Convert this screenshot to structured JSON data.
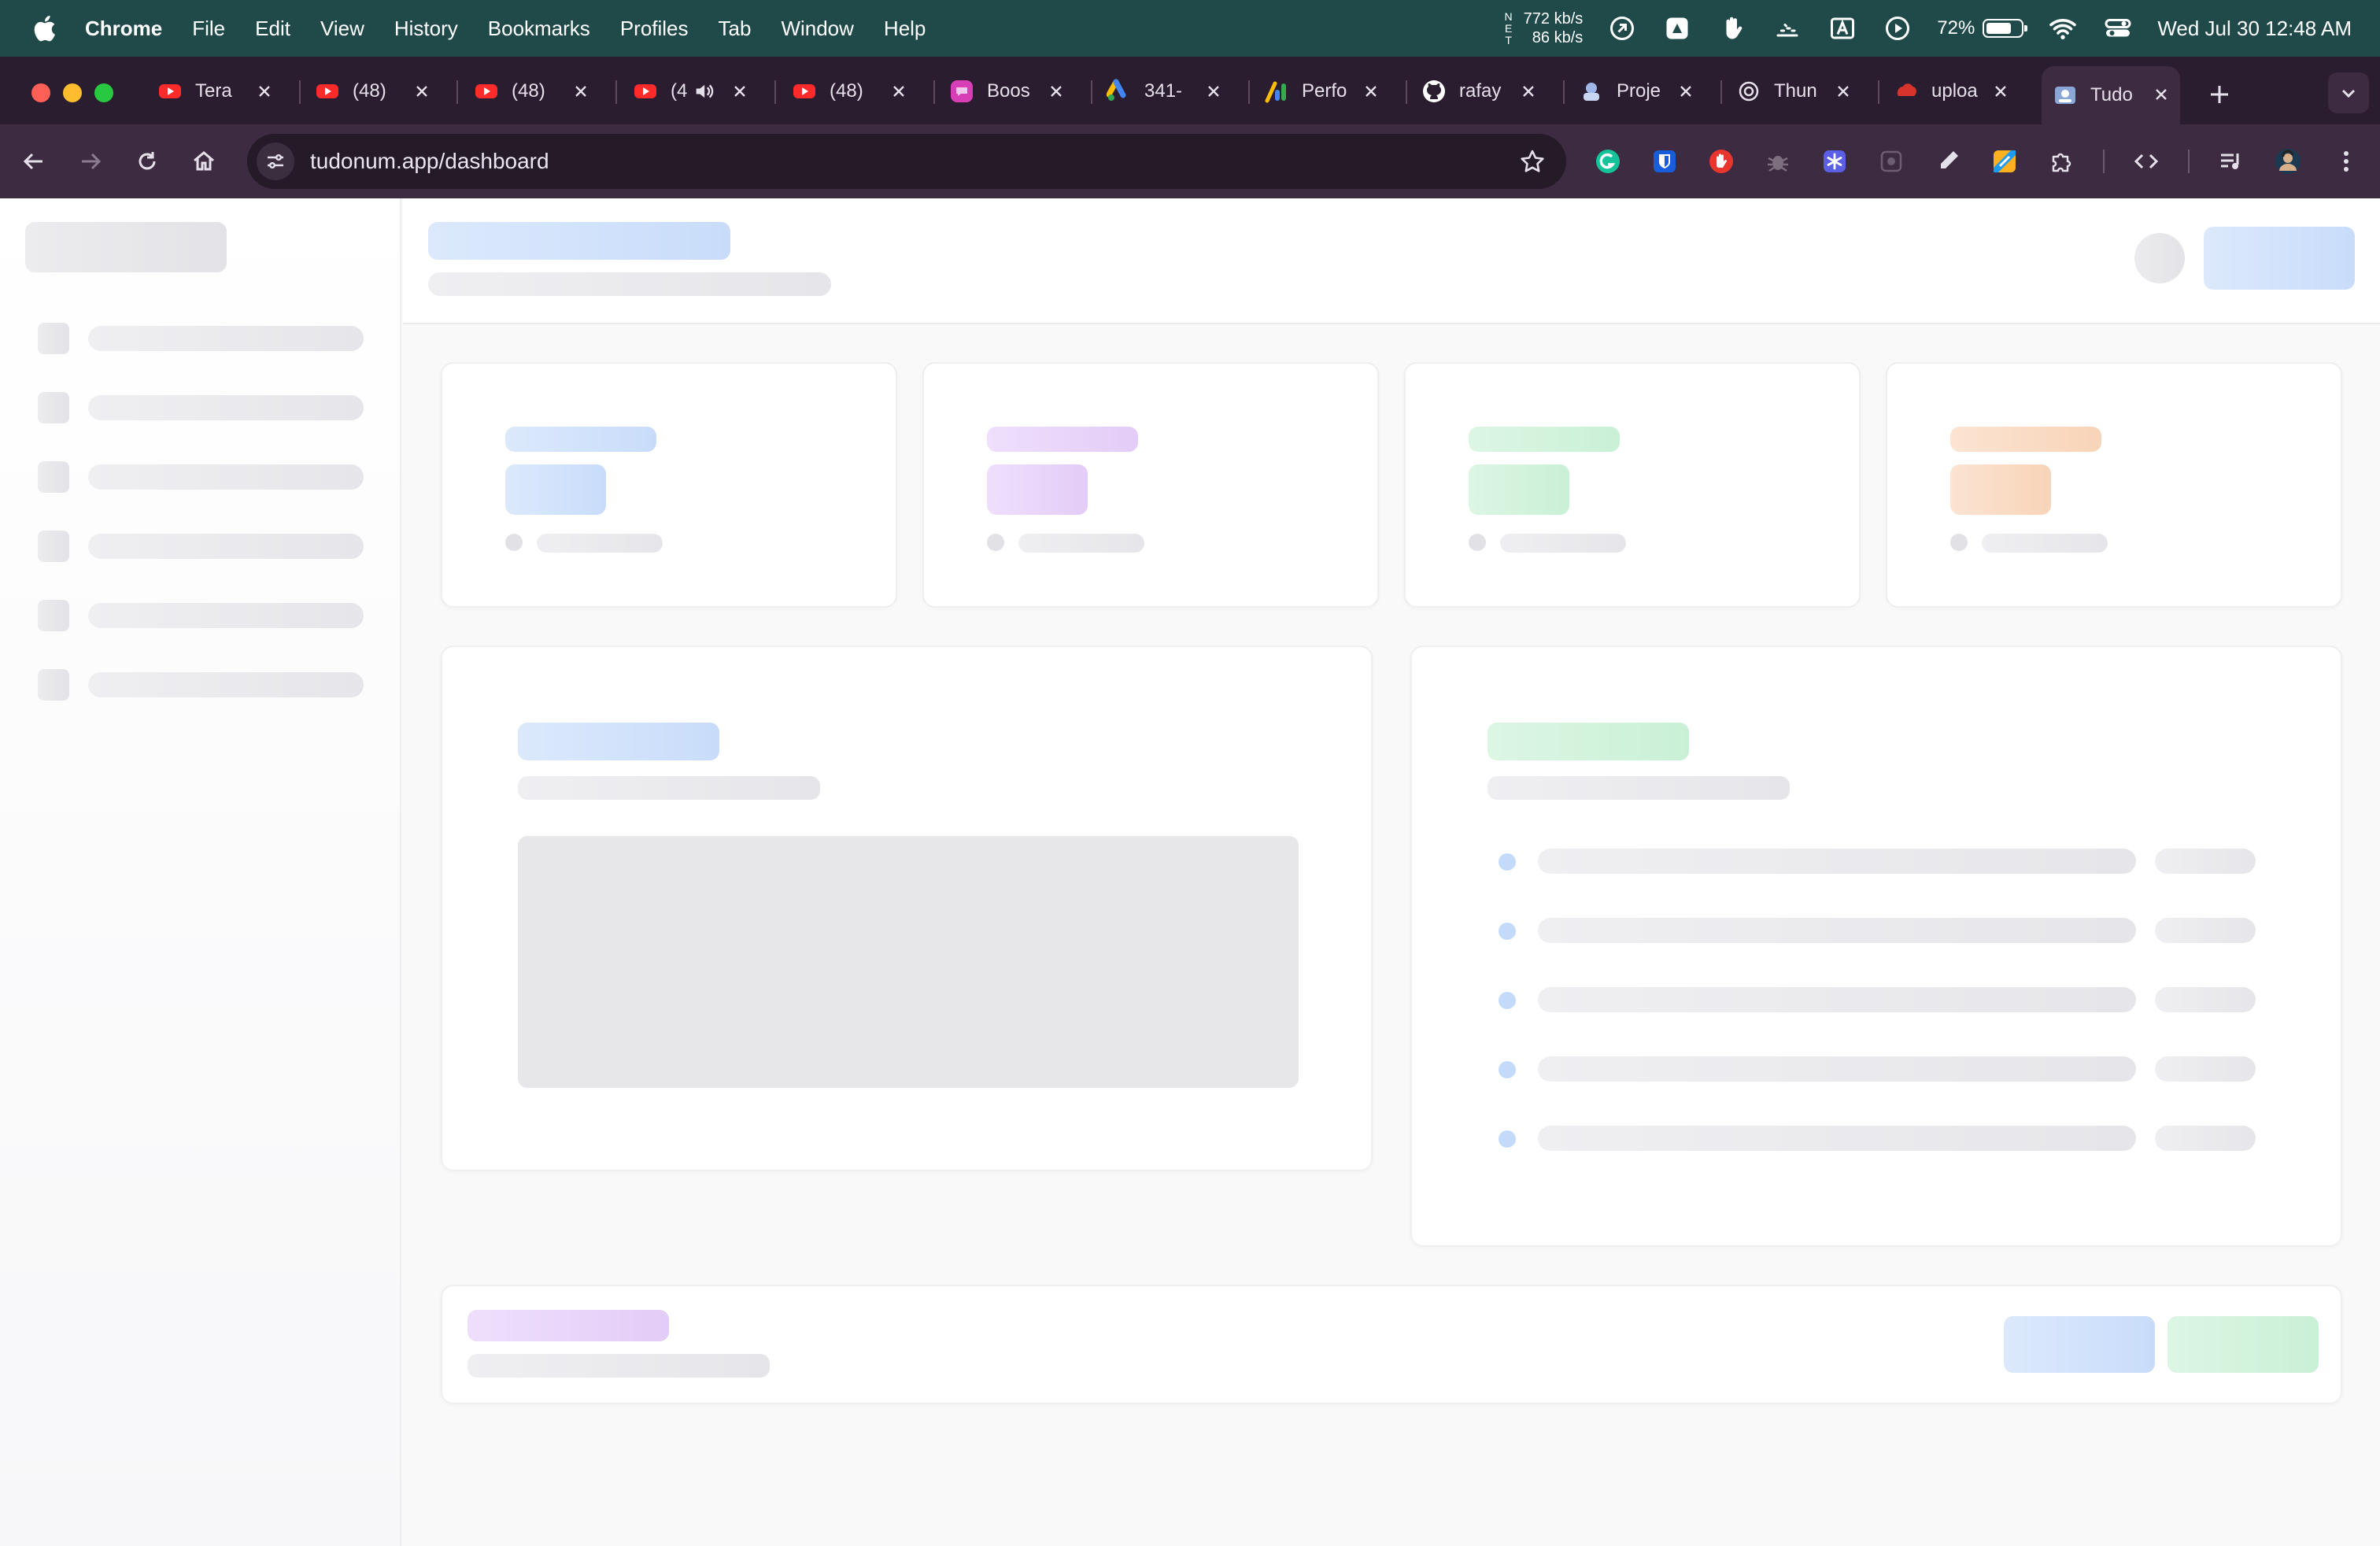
{
  "menubar": {
    "app_name": "Chrome",
    "menus": [
      "File",
      "Edit",
      "View",
      "History",
      "Bookmarks",
      "Profiles",
      "Tab",
      "Window",
      "Help"
    ],
    "network": {
      "letters": [
        "N",
        "E",
        "T"
      ],
      "up": "772 kb/s",
      "down": "86 kb/s"
    },
    "battery_text": "72%",
    "battery_level": 0.72,
    "clock": "Wed Jul 30  12:48 AM"
  },
  "tabs": [
    {
      "title": "Tera",
      "icon": "youtube-icon"
    },
    {
      "title": "(48)",
      "icon": "youtube-icon"
    },
    {
      "title": "(48)",
      "icon": "youtube-icon"
    },
    {
      "title": "(4",
      "icon": "youtube-icon",
      "audio": true
    },
    {
      "title": "(48)",
      "icon": "youtube-icon"
    },
    {
      "title": "Boos",
      "icon": "chat-bubble-icon"
    },
    {
      "title": "341-",
      "icon": "google-ads-icon"
    },
    {
      "title": "Perfo",
      "icon": "analytics-icon"
    },
    {
      "title": "rafay",
      "icon": "github-icon"
    },
    {
      "title": "Proje",
      "icon": "project-icon"
    },
    {
      "title": "Thun",
      "icon": "openai-icon"
    },
    {
      "title": "uploa",
      "icon": "upload-app-icon"
    },
    {
      "title": "Tudo",
      "icon": "tudonum-icon",
      "active": true
    }
  ],
  "address_bar": {
    "url": "tudonum.app/dashboard"
  },
  "extensions": [
    "grammarly-icon",
    "bitwarden-icon",
    "hand-stop-icon",
    "bug-icon",
    "snowflake-icon",
    "screenshot-icon",
    "eyedropper-icon",
    "color-picker-icon",
    "puzzle-icon",
    "code-icon",
    "media-control-icon",
    "profile-avatar-icon"
  ],
  "colors": {
    "menubar": "#1f4a49",
    "tabstrip": "#2b1d30",
    "toolbar": "#3c2b41",
    "skeleton_gray": "#e6e6ea",
    "skeleton_blue": "#c8dcfa",
    "skeleton_purple": "#e3ccf7",
    "skeleton_green": "#c9f0d6",
    "skeleton_orange": "#f8d4b8"
  },
  "dashboard": {
    "state": "loading",
    "sidebar_items": 6,
    "stat_card_accents": [
      "blue",
      "purple",
      "green",
      "orange"
    ],
    "activity_rows": 5
  }
}
